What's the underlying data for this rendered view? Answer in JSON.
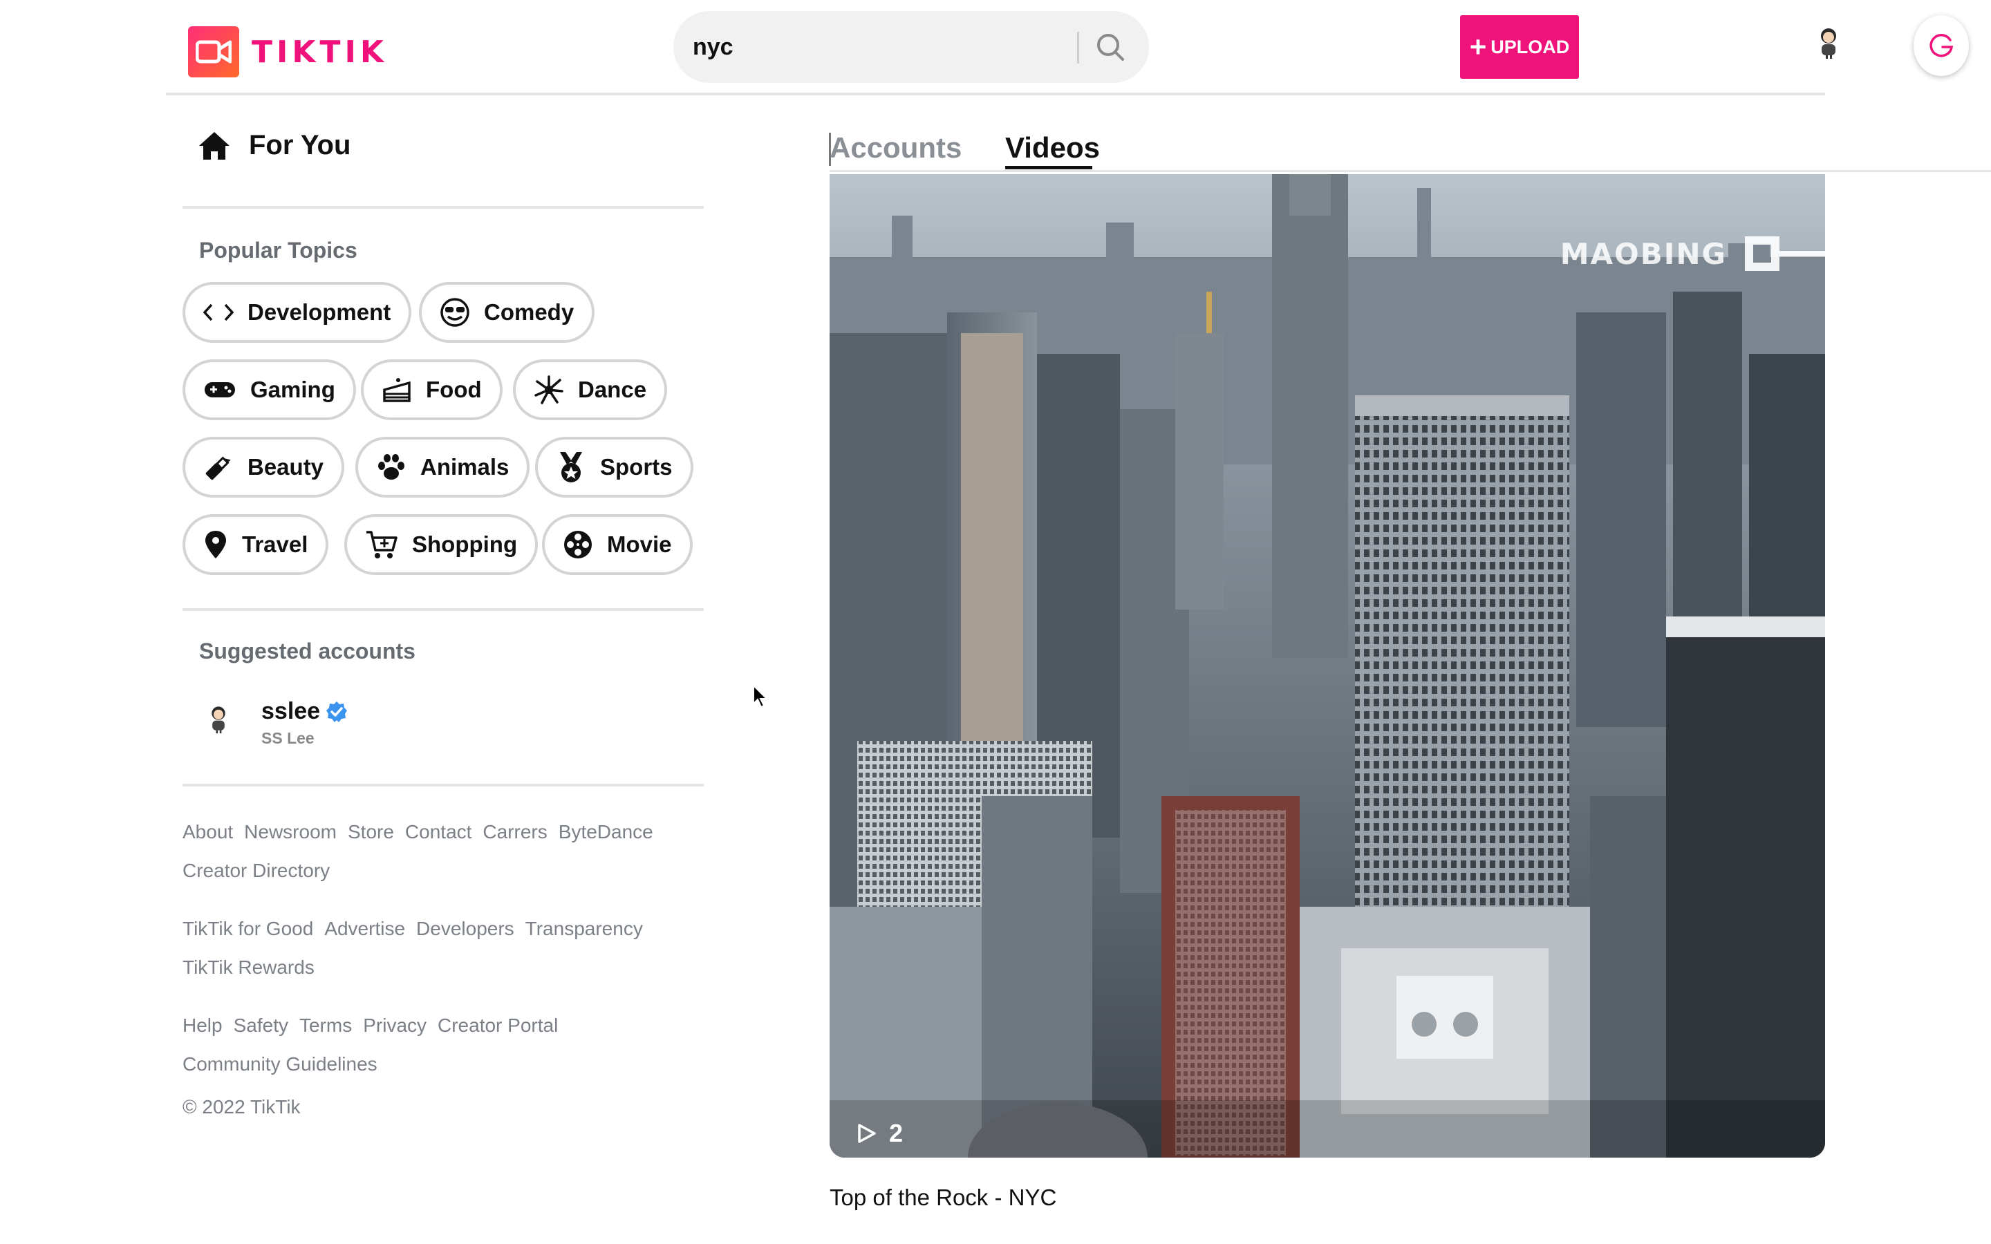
{
  "header": {
    "logo_text": "TIKTIK",
    "search_value": "nyc",
    "upload_label": "UPLOAD"
  },
  "sidebar": {
    "for_you": "For You",
    "popular_title": "Popular Topics",
    "topics": [
      {
        "label": "Development",
        "icon": "code-icon"
      },
      {
        "label": "Comedy",
        "icon": "sunglasses-face-icon"
      },
      {
        "label": "Gaming",
        "icon": "gamepad-icon"
      },
      {
        "label": "Food",
        "icon": "cake-icon"
      },
      {
        "label": "Dance",
        "icon": "sparkle-burst-icon"
      },
      {
        "label": "Beauty",
        "icon": "lipstick-icon"
      },
      {
        "label": "Animals",
        "icon": "paw-icon"
      },
      {
        "label": "Sports",
        "icon": "medal-icon"
      },
      {
        "label": "Travel",
        "icon": "location-pin-icon"
      },
      {
        "label": "Shopping",
        "icon": "cart-icon"
      },
      {
        "label": "Movie",
        "icon": "film-reel-icon"
      }
    ],
    "suggested_title": "Suggested accounts",
    "account": {
      "name": "sslee",
      "subname": "SS Lee",
      "verified": true
    },
    "links_1": [
      "About",
      "Newsroom",
      "Store",
      "Contact",
      "Carrers",
      "ByteDance",
      "Creator Directory"
    ],
    "links_2": [
      "TikTik for Good",
      "Advertise",
      "Developers",
      "Transparency",
      "TikTik Rewards"
    ],
    "links_3": [
      "Help",
      "Safety",
      "Terms",
      "Privacy",
      "Creator Portal",
      "Community Guidelines"
    ],
    "copyright": "© 2022 TikTik"
  },
  "main": {
    "tabs": [
      {
        "label": "Accounts",
        "active": false
      },
      {
        "label": "Videos",
        "active": true
      }
    ],
    "video": {
      "views": "2",
      "watermark": "MAOBING",
      "caption": "Top of the Rock - NYC"
    }
  },
  "colors": {
    "brand": "#f0127b",
    "muted_text": "#7b7f86",
    "border": "#d4d4d4"
  }
}
